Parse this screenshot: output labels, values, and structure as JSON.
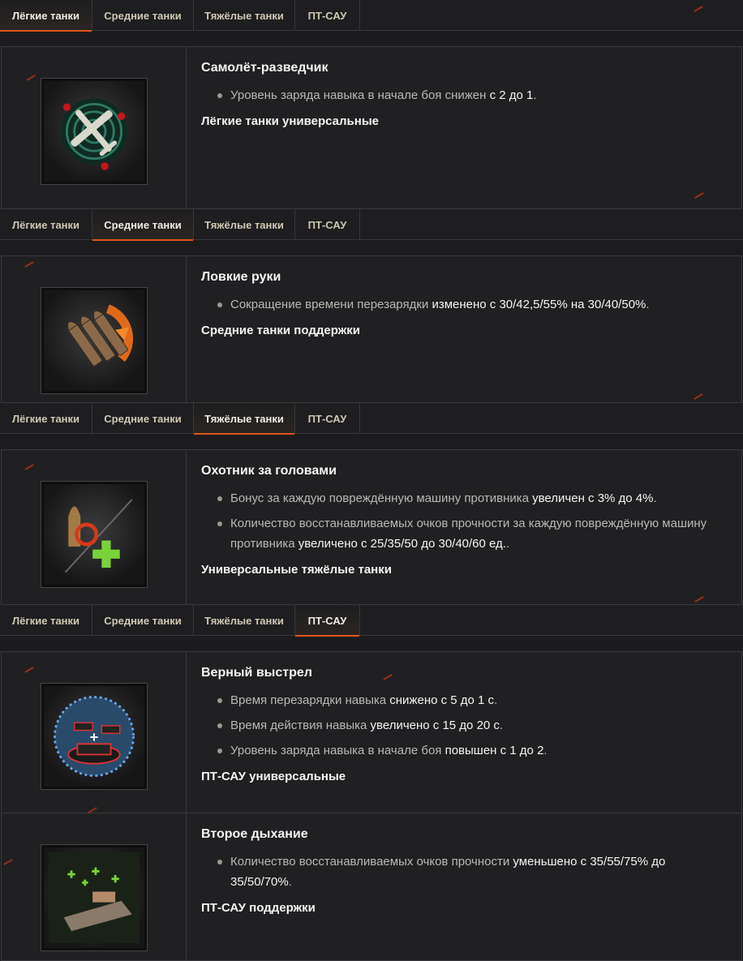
{
  "tabs": [
    "Лёгкие танки",
    "Средние танки",
    "Тяжёлые танки",
    "ПТ-САУ"
  ],
  "sections": [
    {
      "active_tab": 0,
      "cards": [
        {
          "icon": "recon-plane-icon",
          "title": "Самолёт-разведчик",
          "bullets": [
            {
              "text": "Уровень заряда навыка в начале боя снижен",
              "highlight": " с 2 до 1",
              "tail": "."
            }
          ],
          "class_label": "Лёгкие танки универсальные"
        }
      ]
    },
    {
      "active_tab": 1,
      "cards": [
        {
          "icon": "shells-reload-icon",
          "title": "Ловкие руки",
          "bullets": [
            {
              "text": "Сокращение времени перезарядки",
              "highlight": " изменено с 30/42,5/55% на 30/40/50%",
              "tail": "."
            }
          ],
          "class_label": "Средние танки поддержки"
        }
      ]
    },
    {
      "active_tab": 2,
      "cards": [
        {
          "icon": "headhunter-icon",
          "title": "Охотник за головами",
          "bullets": [
            {
              "text": "Бонус за каждую повреждённую машину противника",
              "highlight": " увеличен с 3% до 4%",
              "tail": "."
            },
            {
              "text": "Количество восстанавливаемых очков прочности за каждую повреждённую машину противника",
              "highlight": " увеличено с 25/35/50 до 30/40/60 ед.",
              "tail": "."
            }
          ],
          "class_label": "Универсальные тяжёлые танки"
        }
      ]
    },
    {
      "active_tab": 3,
      "cards": [
        {
          "icon": "true-shot-icon",
          "title": "Верный выстрел",
          "bullets": [
            {
              "text": "Время перезарядки навыка",
              "highlight": " снижено с 5 до 1 с",
              "tail": "."
            },
            {
              "text": "Время действия навыка",
              "highlight": " увеличено с 15 до 20 с",
              "tail": "."
            },
            {
              "text": "Уровень заряда навыка в начале боя",
              "highlight": " повышен с 1 до 2",
              "tail": "."
            }
          ],
          "class_label": "ПТ-САУ универсальные"
        },
        {
          "icon": "second-wind-icon",
          "title": "Второе дыхание",
          "bullets": [
            {
              "text": "Количество восстанавливаемых очков прочности",
              "highlight": " уменьшено с 35/55/75% до 35/50/70%",
              "tail": "."
            }
          ],
          "class_label": "ПТ-САУ поддержки"
        }
      ]
    }
  ]
}
